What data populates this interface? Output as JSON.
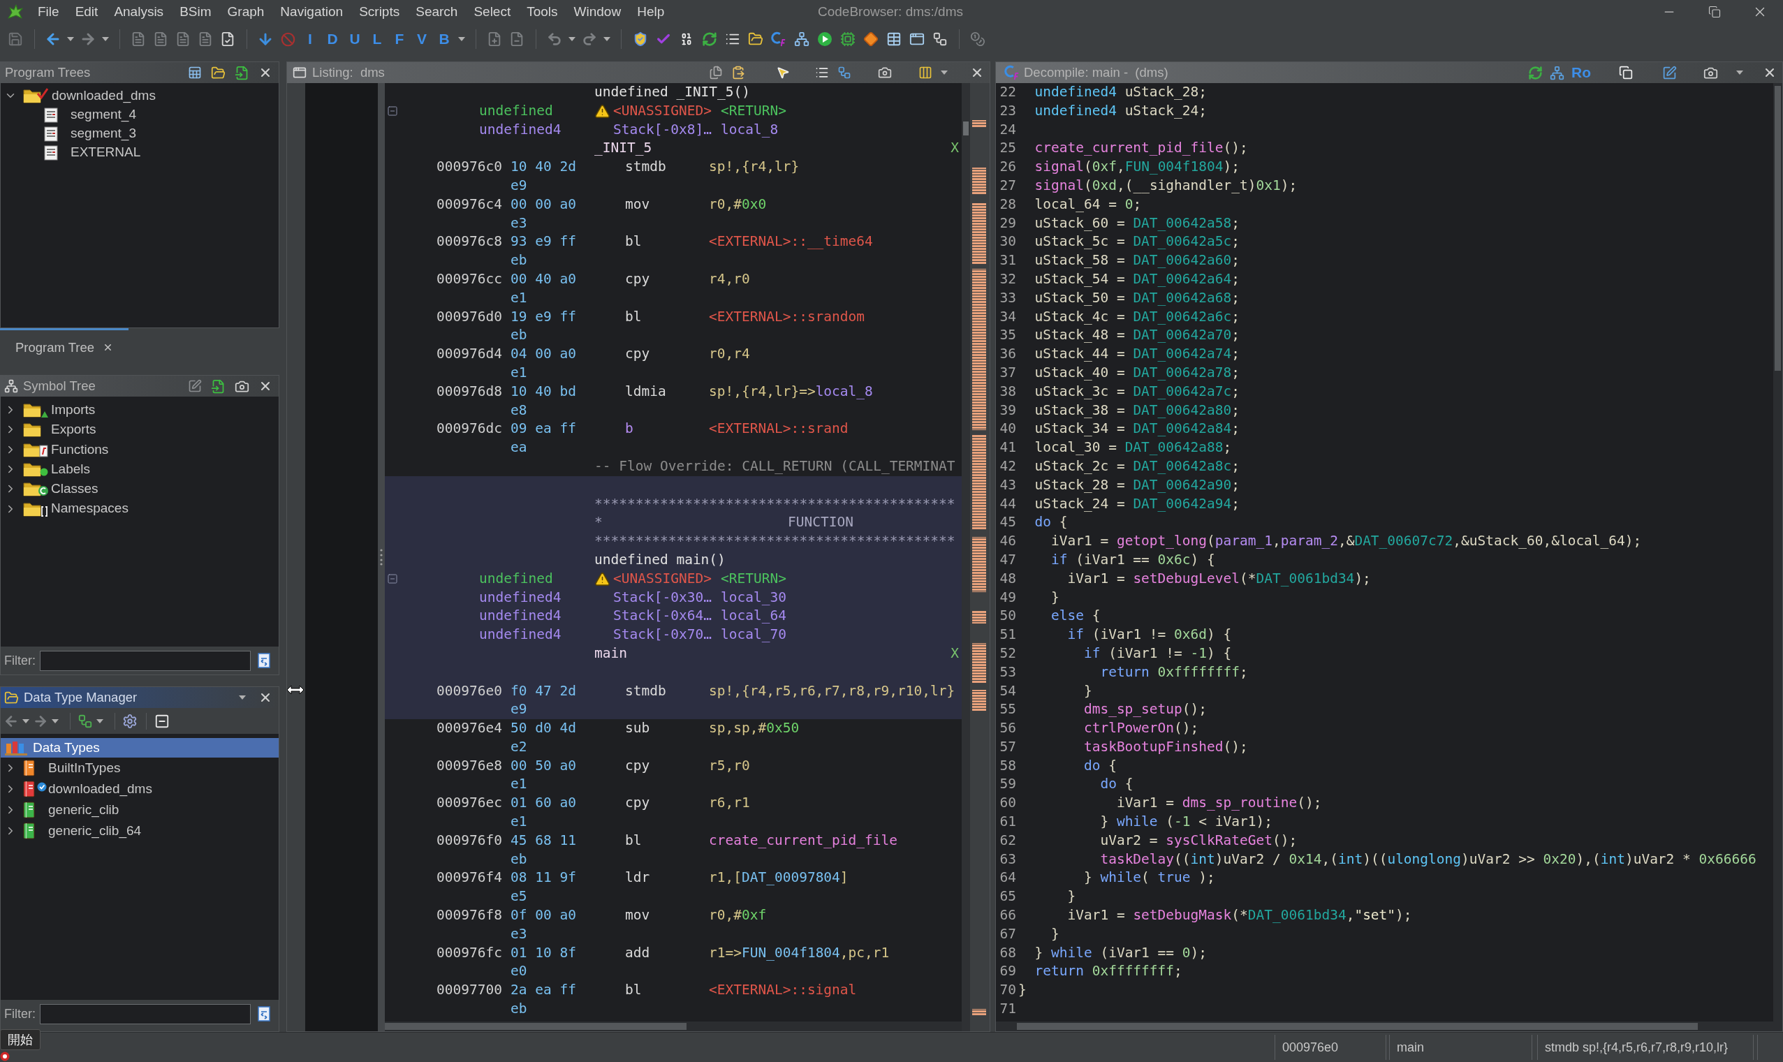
{
  "window": {
    "title": "CodeBrowser: dms:/dms"
  },
  "menu": [
    "File",
    "Edit",
    "Analysis",
    "BSim",
    "Graph",
    "Navigation",
    "Scripts",
    "Search",
    "Select",
    "Tools",
    "Window",
    "Help"
  ],
  "toolbar": {
    "letter_buttons": [
      "I",
      "D",
      "U",
      "L",
      "F",
      "V",
      "B"
    ]
  },
  "program_trees": {
    "title": "Program Trees",
    "focused": false,
    "tree": [
      {
        "label": "downloaded_dms",
        "expanded": true,
        "selected": false,
        "children": [
          {
            "label": "segment_4",
            "selected": false
          },
          {
            "label": "segment_3",
            "selected": false
          },
          {
            "label": "EXTERNAL",
            "selected": false
          }
        ]
      }
    ],
    "tabs": [
      {
        "label": "Program Tree",
        "selected": true
      }
    ]
  },
  "symbol_tree": {
    "title": "Symbol Tree",
    "focused": false,
    "items": [
      {
        "label": "Imports",
        "kind": "imports",
        "expanded": false,
        "selected": false
      },
      {
        "label": "Exports",
        "kind": "exports",
        "expanded": false,
        "selected": false
      },
      {
        "label": "Functions",
        "kind": "functions",
        "expanded": false,
        "selected": false
      },
      {
        "label": "Labels",
        "kind": "labels",
        "expanded": false,
        "selected": false
      },
      {
        "label": "Classes",
        "kind": "classes",
        "expanded": false,
        "selected": false
      },
      {
        "label": "Namespaces",
        "kind": "namespaces",
        "expanded": false,
        "selected": false
      }
    ],
    "filter": {
      "label": "Filter:"
    }
  },
  "data_type_manager": {
    "title": "Data Type Manager",
    "focused": true,
    "root": {
      "label": "Data Types",
      "selected": true
    },
    "items": [
      {
        "label": "BuiltInTypes",
        "kind": "builtin",
        "expanded": false,
        "selected": false
      },
      {
        "label": "downloaded_dms",
        "kind": "program",
        "expanded": false,
        "selected": false
      },
      {
        "label": "generic_clib",
        "kind": "archive",
        "expanded": false,
        "selected": false
      },
      {
        "label": "generic_clib_64",
        "kind": "archive",
        "expanded": false,
        "selected": false
      }
    ],
    "filter": {
      "label": "Filter:"
    }
  },
  "listing": {
    "title": "Listing:  dms",
    "focused": false,
    "blocks": [
      {
        "highlighted": false,
        "rows": [
          {
            "kind": "signature",
            "text": "undefined _INIT_5()"
          },
          {
            "kind": "return_variable",
            "expanded": true,
            "warning": true,
            "type": "undefined",
            "storage": "<UNASSIGNED>",
            "name": "<RETURN>"
          },
          {
            "kind": "local_variable",
            "type": "undefined4",
            "storage": "Stack[-0x8]…",
            "name": "local_8"
          },
          {
            "kind": "label",
            "text": "_INIT_5",
            "xref": "X"
          },
          {
            "kind": "instruction",
            "address": "000976c0",
            "bytes": "10 40 2d",
            "mnemonic": "stmdb",
            "flow_override": false,
            "operands": [
              {
                "text": "sp!,{r4,lr}",
                "kind": "register"
              }
            ]
          },
          {
            "kind": "bytes",
            "bytes": "e9"
          },
          {
            "kind": "instruction",
            "address": "000976c4",
            "bytes": "00 00 a0",
            "mnemonic": "mov",
            "flow_override": false,
            "operands": [
              {
                "text": "r0,#",
                "kind": "register"
              },
              {
                "text": "0x0",
                "kind": "scalar"
              }
            ]
          },
          {
            "kind": "bytes",
            "bytes": "e3"
          },
          {
            "kind": "instruction",
            "address": "000976c8",
            "bytes": "93 e9 ff",
            "mnemonic": "bl",
            "flow_override": false,
            "operands": [
              {
                "text": "<EXTERNAL>::__time64",
                "kind": "external"
              }
            ]
          },
          {
            "kind": "bytes",
            "bytes": "eb"
          },
          {
            "kind": "instruction",
            "address": "000976cc",
            "bytes": "00 40 a0",
            "mnemonic": "cpy",
            "flow_override": false,
            "operands": [
              {
                "text": "r4,r0",
                "kind": "register"
              }
            ]
          },
          {
            "kind": "bytes",
            "bytes": "e1"
          },
          {
            "kind": "instruction",
            "address": "000976d0",
            "bytes": "19 e9 ff",
            "mnemonic": "bl",
            "flow_override": false,
            "operands": [
              {
                "text": "<EXTERNAL>::srandom",
                "kind": "external"
              }
            ]
          },
          {
            "kind": "bytes",
            "bytes": "eb"
          },
          {
            "kind": "instruction",
            "address": "000976d4",
            "bytes": "04 00 a0",
            "mnemonic": "cpy",
            "flow_override": false,
            "operands": [
              {
                "text": "r0,r4",
                "kind": "register"
              }
            ]
          },
          {
            "kind": "bytes",
            "bytes": "e1"
          },
          {
            "kind": "instruction",
            "address": "000976d8",
            "bytes": "10 40 bd",
            "mnemonic": "ldmia",
            "flow_override": false,
            "operands": [
              {
                "text": "sp!,{r4,lr}=>",
                "kind": "register"
              },
              {
                "text": "local_8",
                "kind": "local"
              }
            ]
          },
          {
            "kind": "bytes",
            "bytes": "e8"
          },
          {
            "kind": "instruction",
            "address": "000976dc",
            "bytes": "09 ea ff",
            "mnemonic": "b",
            "flow_override": true,
            "operands": [
              {
                "text": "<EXTERNAL>::srand",
                "kind": "external"
              }
            ]
          },
          {
            "kind": "bytes",
            "bytes": "ea"
          },
          {
            "kind": "comment",
            "text": "-- Flow Override: CALL_RETURN (CALL_TERMINAT"
          }
        ]
      },
      {
        "highlighted": true,
        "rows": [
          {
            "kind": "blank"
          },
          {
            "kind": "banner",
            "text": "********************************************"
          },
          {
            "kind": "banner_title",
            "mark": "*",
            "title": "FUNCTION"
          },
          {
            "kind": "banner",
            "text": "********************************************"
          },
          {
            "kind": "signature",
            "text": "undefined main()"
          },
          {
            "kind": "return_variable",
            "expanded": true,
            "warning": true,
            "type": "undefined",
            "storage": "<UNASSIGNED>",
            "name": "<RETURN>"
          },
          {
            "kind": "local_variable",
            "type": "undefined4",
            "storage": "Stack[-0x30…",
            "name": "local_30"
          },
          {
            "kind": "local_variable",
            "type": "undefined4",
            "storage": "Stack[-0x64…",
            "name": "local_64"
          },
          {
            "kind": "local_variable",
            "type": "undefined4",
            "storage": "Stack[-0x70…",
            "name": "local_70"
          },
          {
            "kind": "label",
            "text": "main",
            "xref": "X"
          },
          {
            "kind": "blank"
          },
          {
            "kind": "instruction",
            "address": "000976e0",
            "bytes": "f0 47 2d",
            "mnemonic": "stmdb",
            "flow_override": false,
            "operands": [
              {
                "text": "sp!,{r4,r5,r6,r7,r8,r9,r10,lr}",
                "kind": "register"
              }
            ]
          },
          {
            "kind": "bytes",
            "bytes": "e9"
          }
        ]
      },
      {
        "highlighted": false,
        "rows": [
          {
            "kind": "instruction",
            "address": "000976e4",
            "bytes": "50 d0 4d",
            "mnemonic": "sub",
            "flow_override": false,
            "operands": [
              {
                "text": "sp,sp,#",
                "kind": "register"
              },
              {
                "text": "0x50",
                "kind": "scalar"
              }
            ]
          },
          {
            "kind": "bytes",
            "bytes": "e2"
          },
          {
            "kind": "instruction",
            "address": "000976e8",
            "bytes": "00 50 a0",
            "mnemonic": "cpy",
            "flow_override": false,
            "operands": [
              {
                "text": "r5,r0",
                "kind": "register"
              }
            ]
          },
          {
            "kind": "bytes",
            "bytes": "e1"
          },
          {
            "kind": "instruction",
            "address": "000976ec",
            "bytes": "01 60 a0",
            "mnemonic": "cpy",
            "flow_override": false,
            "operands": [
              {
                "text": "r6,r1",
                "kind": "register"
              }
            ]
          },
          {
            "kind": "bytes",
            "bytes": "e1"
          },
          {
            "kind": "instruction",
            "address": "000976f0",
            "bytes": "45 68 11",
            "mnemonic": "bl",
            "flow_override": false,
            "operands": [
              {
                "text": "create_current_pid_file",
                "kind": "function"
              }
            ]
          },
          {
            "kind": "bytes",
            "bytes": "eb"
          },
          {
            "kind": "instruction",
            "address": "000976f4",
            "bytes": "08 11 9f",
            "mnemonic": "ldr",
            "flow_override": false,
            "operands": [
              {
                "text": "r1,[",
                "kind": "register"
              },
              {
                "text": "DAT_00097804",
                "kind": "reference"
              },
              {
                "text": "]",
                "kind": "register"
              }
            ]
          },
          {
            "kind": "bytes",
            "bytes": "e5"
          },
          {
            "kind": "instruction",
            "address": "000976f8",
            "bytes": "0f 00 a0",
            "mnemonic": "mov",
            "flow_override": false,
            "operands": [
              {
                "text": "r0,#",
                "kind": "register"
              },
              {
                "text": "0xf",
                "kind": "scalar"
              }
            ]
          },
          {
            "kind": "bytes",
            "bytes": "e3"
          },
          {
            "kind": "instruction",
            "address": "000976fc",
            "bytes": "01 10 8f",
            "mnemonic": "add",
            "flow_override": false,
            "operands": [
              {
                "text": "r1=>",
                "kind": "register"
              },
              {
                "text": "FUN_004f1804",
                "kind": "reference"
              },
              {
                "text": ",pc,r1",
                "kind": "register"
              }
            ]
          },
          {
            "kind": "bytes",
            "bytes": "e0"
          },
          {
            "kind": "instruction",
            "address": "00097700",
            "bytes": "2a ea ff",
            "mnemonic": "bl",
            "flow_override": false,
            "operands": [
              {
                "text": "<EXTERNAL>::signal",
                "kind": "external"
              }
            ]
          },
          {
            "kind": "bytes",
            "bytes": "eb"
          }
        ]
      }
    ]
  },
  "decompile": {
    "title": "Decompile: main -  (dms)",
    "focused": false,
    "toolbar_label": "Ro",
    "lines": [
      {
        "number": "22",
        "tokens": [
          {
            "text": "  undefined4",
            "kind": "type"
          },
          {
            "text": " uStack_28;",
            "kind": "plain"
          }
        ]
      },
      {
        "number": "23",
        "tokens": [
          {
            "text": "  undefined4",
            "kind": "type"
          },
          {
            "text": " uStack_24;",
            "kind": "plain"
          }
        ]
      },
      {
        "number": "24"
      },
      {
        "number": "25",
        "tokens": [
          {
            "text": "  create_current_pid_file",
            "kind": "func"
          },
          {
            "text": "();",
            "kind": "plain"
          }
        ]
      },
      {
        "number": "26",
        "tokens": [
          {
            "text": "  signal",
            "kind": "func"
          },
          {
            "text": "(",
            "kind": "plain"
          },
          {
            "text": "0xf",
            "kind": "const"
          },
          {
            "text": ",",
            "kind": "plain"
          },
          {
            "text": "FUN_004f1804",
            "kind": "global"
          },
          {
            "text": ");",
            "kind": "plain"
          }
        ]
      },
      {
        "number": "27",
        "tokens": [
          {
            "text": "  signal",
            "kind": "func"
          },
          {
            "text": "(",
            "kind": "plain"
          },
          {
            "text": "0xd",
            "kind": "const"
          },
          {
            "text": ",(__sighandler_t)",
            "kind": "plain"
          },
          {
            "text": "0x1",
            "kind": "const"
          },
          {
            "text": ");",
            "kind": "plain"
          }
        ]
      },
      {
        "number": "28",
        "tokens": [
          {
            "text": "  local_64 = ",
            "kind": "plain"
          },
          {
            "text": "0",
            "kind": "const"
          },
          {
            "text": ";",
            "kind": "plain"
          }
        ]
      },
      {
        "number": "29",
        "tokens": [
          {
            "text": "  uStack_60 = ",
            "kind": "plain"
          },
          {
            "text": "DAT_00642a58",
            "kind": "global"
          },
          {
            "text": ";",
            "kind": "plain"
          }
        ]
      },
      {
        "number": "30",
        "tokens": [
          {
            "text": "  uStack_5c = ",
            "kind": "plain"
          },
          {
            "text": "DAT_00642a5c",
            "kind": "global"
          },
          {
            "text": ";",
            "kind": "plain"
          }
        ]
      },
      {
        "number": "31",
        "tokens": [
          {
            "text": "  uStack_58 = ",
            "kind": "plain"
          },
          {
            "text": "DAT_00642a60",
            "kind": "global"
          },
          {
            "text": ";",
            "kind": "plain"
          }
        ]
      },
      {
        "number": "32",
        "tokens": [
          {
            "text": "  uStack_54 = ",
            "kind": "plain"
          },
          {
            "text": "DAT_00642a64",
            "kind": "global"
          },
          {
            "text": ";",
            "kind": "plain"
          }
        ]
      },
      {
        "number": "33",
        "tokens": [
          {
            "text": "  uStack_50 = ",
            "kind": "plain"
          },
          {
            "text": "DAT_00642a68",
            "kind": "global"
          },
          {
            "text": ";",
            "kind": "plain"
          }
        ]
      },
      {
        "number": "34",
        "tokens": [
          {
            "text": "  uStack_4c = ",
            "kind": "plain"
          },
          {
            "text": "DAT_00642a6c",
            "kind": "global"
          },
          {
            "text": ";",
            "kind": "plain"
          }
        ]
      },
      {
        "number": "35",
        "tokens": [
          {
            "text": "  uStack_48 = ",
            "kind": "plain"
          },
          {
            "text": "DAT_00642a70",
            "kind": "global"
          },
          {
            "text": ";",
            "kind": "plain"
          }
        ]
      },
      {
        "number": "36",
        "tokens": [
          {
            "text": "  uStack_44 = ",
            "kind": "plain"
          },
          {
            "text": "DAT_00642a74",
            "kind": "global"
          },
          {
            "text": ";",
            "kind": "plain"
          }
        ]
      },
      {
        "number": "37",
        "tokens": [
          {
            "text": "  uStack_40 = ",
            "kind": "plain"
          },
          {
            "text": "DAT_00642a78",
            "kind": "global"
          },
          {
            "text": ";",
            "kind": "plain"
          }
        ]
      },
      {
        "number": "38",
        "tokens": [
          {
            "text": "  uStack_3c = ",
            "kind": "plain"
          },
          {
            "text": "DAT_00642a7c",
            "kind": "global"
          },
          {
            "text": ";",
            "kind": "plain"
          }
        ]
      },
      {
        "number": "39",
        "tokens": [
          {
            "text": "  uStack_38 = ",
            "kind": "plain"
          },
          {
            "text": "DAT_00642a80",
            "kind": "global"
          },
          {
            "text": ";",
            "kind": "plain"
          }
        ]
      },
      {
        "number": "40",
        "tokens": [
          {
            "text": "  uStack_34 = ",
            "kind": "plain"
          },
          {
            "text": "DAT_00642a84",
            "kind": "global"
          },
          {
            "text": ";",
            "kind": "plain"
          }
        ]
      },
      {
        "number": "41",
        "tokens": [
          {
            "text": "  local_30 = ",
            "kind": "plain"
          },
          {
            "text": "DAT_00642a88",
            "kind": "global"
          },
          {
            "text": ";",
            "kind": "plain"
          }
        ]
      },
      {
        "number": "42",
        "tokens": [
          {
            "text": "  uStack_2c = ",
            "kind": "plain"
          },
          {
            "text": "DAT_00642a8c",
            "kind": "global"
          },
          {
            "text": ";",
            "kind": "plain"
          }
        ]
      },
      {
        "number": "43",
        "tokens": [
          {
            "text": "  uStack_28 = ",
            "kind": "plain"
          },
          {
            "text": "DAT_00642a90",
            "kind": "global"
          },
          {
            "text": ";",
            "kind": "plain"
          }
        ]
      },
      {
        "number": "44",
        "tokens": [
          {
            "text": "  uStack_24 = ",
            "kind": "plain"
          },
          {
            "text": "DAT_00642a94",
            "kind": "global"
          },
          {
            "text": ";",
            "kind": "plain"
          }
        ]
      },
      {
        "number": "45",
        "tokens": [
          {
            "text": "  do",
            "kind": "keyword"
          },
          {
            "text": " {",
            "kind": "plain"
          }
        ]
      },
      {
        "number": "46",
        "tokens": [
          {
            "text": "    iVar1 = ",
            "kind": "plain"
          },
          {
            "text": "getopt_long",
            "kind": "func"
          },
          {
            "text": "(",
            "kind": "plain"
          },
          {
            "text": "param_1",
            "kind": "param"
          },
          {
            "text": ",",
            "kind": "plain"
          },
          {
            "text": "param_2",
            "kind": "param"
          },
          {
            "text": ",&",
            "kind": "plain"
          },
          {
            "text": "DAT_00607c72",
            "kind": "global"
          },
          {
            "text": ",&uStack_60,&local_64);",
            "kind": "plain"
          }
        ]
      },
      {
        "number": "47",
        "tokens": [
          {
            "text": "    if",
            "kind": "keyword"
          },
          {
            "text": " (iVar1 == ",
            "kind": "plain"
          },
          {
            "text": "0x6c",
            "kind": "const"
          },
          {
            "text": ") {",
            "kind": "plain"
          }
        ]
      },
      {
        "number": "48",
        "tokens": [
          {
            "text": "      iVar1 = ",
            "kind": "plain"
          },
          {
            "text": "setDebugLevel",
            "kind": "func"
          },
          {
            "text": "(*",
            "kind": "plain"
          },
          {
            "text": "DAT_0061bd34",
            "kind": "global"
          },
          {
            "text": ");",
            "kind": "plain"
          }
        ]
      },
      {
        "number": "49",
        "tokens": [
          {
            "text": "    }",
            "kind": "plain"
          }
        ]
      },
      {
        "number": "50",
        "tokens": [
          {
            "text": "    else",
            "kind": "keyword"
          },
          {
            "text": " {",
            "kind": "plain"
          }
        ]
      },
      {
        "number": "51",
        "tokens": [
          {
            "text": "      if",
            "kind": "keyword"
          },
          {
            "text": " (iVar1 != ",
            "kind": "plain"
          },
          {
            "text": "0x6d",
            "kind": "const"
          },
          {
            "text": ") {",
            "kind": "plain"
          }
        ]
      },
      {
        "number": "52",
        "tokens": [
          {
            "text": "        if",
            "kind": "keyword"
          },
          {
            "text": " (iVar1 != ",
            "kind": "plain"
          },
          {
            "text": "-1",
            "kind": "const"
          },
          {
            "text": ") {",
            "kind": "plain"
          }
        ]
      },
      {
        "number": "53",
        "tokens": [
          {
            "text": "          return ",
            "kind": "keyword"
          },
          {
            "text": "0xffffffff",
            "kind": "const"
          },
          {
            "text": ";",
            "kind": "plain"
          }
        ]
      },
      {
        "number": "54",
        "tokens": [
          {
            "text": "        }",
            "kind": "plain"
          }
        ]
      },
      {
        "number": "55",
        "tokens": [
          {
            "text": "        dms_sp_setup",
            "kind": "func"
          },
          {
            "text": "();",
            "kind": "plain"
          }
        ]
      },
      {
        "number": "56",
        "tokens": [
          {
            "text": "        ctrlPowerOn",
            "kind": "func"
          },
          {
            "text": "();",
            "kind": "plain"
          }
        ]
      },
      {
        "number": "57",
        "tokens": [
          {
            "text": "        taskBootupFinshed",
            "kind": "func"
          },
          {
            "text": "();",
            "kind": "plain"
          }
        ]
      },
      {
        "number": "58",
        "tokens": [
          {
            "text": "        do",
            "kind": "keyword"
          },
          {
            "text": " {",
            "kind": "plain"
          }
        ]
      },
      {
        "number": "59",
        "tokens": [
          {
            "text": "          do",
            "kind": "keyword"
          },
          {
            "text": " {",
            "kind": "plain"
          }
        ]
      },
      {
        "number": "60",
        "tokens": [
          {
            "text": "            iVar1 = ",
            "kind": "plain"
          },
          {
            "text": "dms_sp_routine",
            "kind": "func"
          },
          {
            "text": "();",
            "kind": "plain"
          }
        ]
      },
      {
        "number": "61",
        "tokens": [
          {
            "text": "          } ",
            "kind": "plain"
          },
          {
            "text": "while",
            "kind": "keyword"
          },
          {
            "text": " (",
            "kind": "plain"
          },
          {
            "text": "-1",
            "kind": "const"
          },
          {
            "text": " < iVar1);",
            "kind": "plain"
          }
        ]
      },
      {
        "number": "62",
        "tokens": [
          {
            "text": "          uVar2 = ",
            "kind": "plain"
          },
          {
            "text": "sysClkRateGet",
            "kind": "func"
          },
          {
            "text": "();",
            "kind": "plain"
          }
        ]
      },
      {
        "number": "63",
        "tokens": [
          {
            "text": "          taskDelay",
            "kind": "func"
          },
          {
            "text": "((",
            "kind": "plain"
          },
          {
            "text": "int",
            "kind": "type"
          },
          {
            "text": ")uVar2 / ",
            "kind": "plain"
          },
          {
            "text": "0x14",
            "kind": "const"
          },
          {
            "text": ",(",
            "kind": "plain"
          },
          {
            "text": "int",
            "kind": "type"
          },
          {
            "text": ")((",
            "kind": "plain"
          },
          {
            "text": "ulonglong",
            "kind": "type"
          },
          {
            "text": ")uVar2 >> ",
            "kind": "plain"
          },
          {
            "text": "0x20",
            "kind": "const"
          },
          {
            "text": "),(",
            "kind": "plain"
          },
          {
            "text": "int",
            "kind": "type"
          },
          {
            "text": ")uVar2 * ",
            "kind": "plain"
          },
          {
            "text": "0x66666",
            "kind": "const"
          }
        ]
      },
      {
        "number": "64",
        "tokens": [
          {
            "text": "        } ",
            "kind": "plain"
          },
          {
            "text": "while",
            "kind": "keyword"
          },
          {
            "text": "( ",
            "kind": "plain"
          },
          {
            "text": "true",
            "kind": "keyword"
          },
          {
            "text": " );",
            "kind": "plain"
          }
        ]
      },
      {
        "number": "65",
        "tokens": [
          {
            "text": "      }",
            "kind": "plain"
          }
        ]
      },
      {
        "number": "66",
        "tokens": [
          {
            "text": "      iVar1 = ",
            "kind": "plain"
          },
          {
            "text": "setDebugMask",
            "kind": "func"
          },
          {
            "text": "(*",
            "kind": "plain"
          },
          {
            "text": "DAT_0061bd34",
            "kind": "global"
          },
          {
            "text": ",",
            "kind": "plain"
          },
          {
            "text": "\"set\"",
            "kind": "string"
          },
          {
            "text": ");",
            "kind": "plain"
          }
        ]
      },
      {
        "number": "67",
        "tokens": [
          {
            "text": "    }",
            "kind": "plain"
          }
        ]
      },
      {
        "number": "68",
        "tokens": [
          {
            "text": "  } ",
            "kind": "plain"
          },
          {
            "text": "while",
            "kind": "keyword"
          },
          {
            "text": " (iVar1 == ",
            "kind": "plain"
          },
          {
            "text": "0",
            "kind": "const"
          },
          {
            "text": ");",
            "kind": "plain"
          }
        ]
      },
      {
        "number": "69",
        "tokens": [
          {
            "text": "  return ",
            "kind": "keyword"
          },
          {
            "text": "0xffffffff",
            "kind": "const"
          },
          {
            "text": ";",
            "kind": "plain"
          }
        ]
      },
      {
        "number": "70",
        "tokens": [
          {
            "text": "}",
            "kind": "plain"
          }
        ]
      },
      {
        "number": "71"
      }
    ]
  },
  "status_bar": {
    "fields": [
      "000976e0",
      "main",
      "stmdb sp!,{r4,r5,r6,r7,r8,r9,r10,lr}"
    ]
  },
  "tooltip": {
    "text": "開始"
  }
}
